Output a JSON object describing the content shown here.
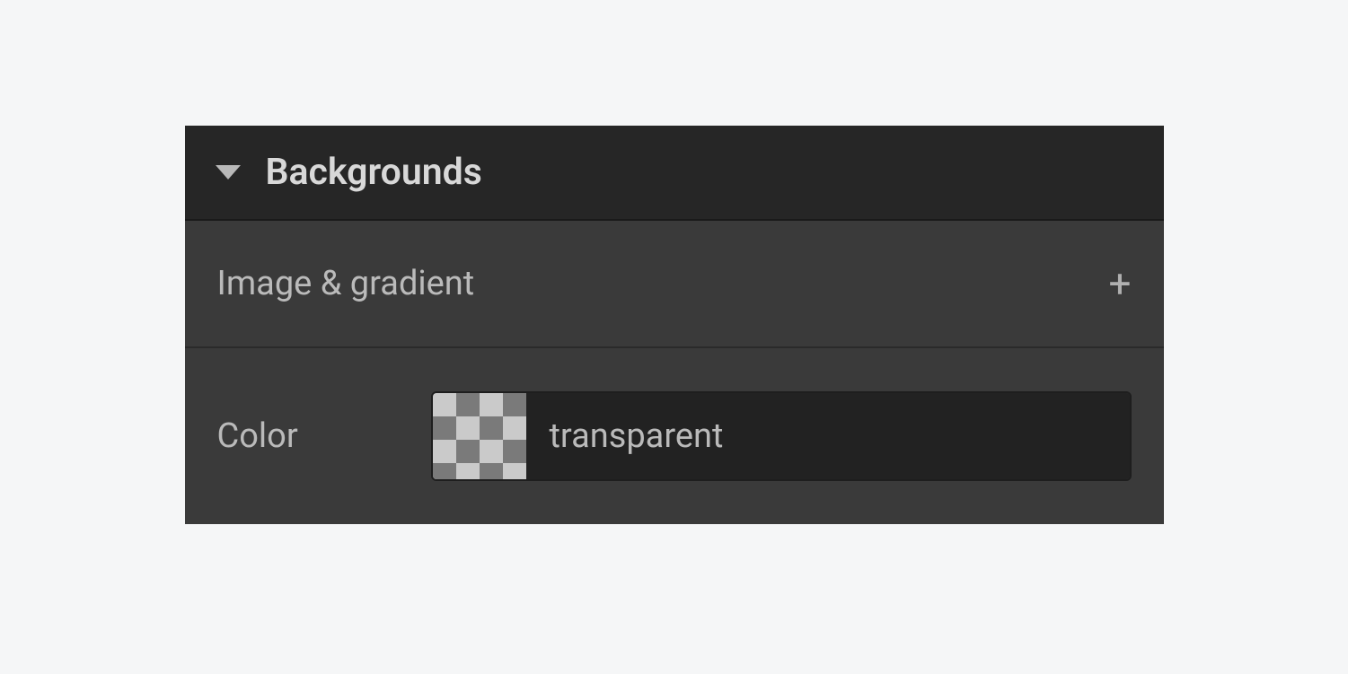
{
  "section": {
    "title": "Backgrounds"
  },
  "imageGradient": {
    "label": "Image & gradient"
  },
  "color": {
    "label": "Color",
    "value": "transparent"
  }
}
